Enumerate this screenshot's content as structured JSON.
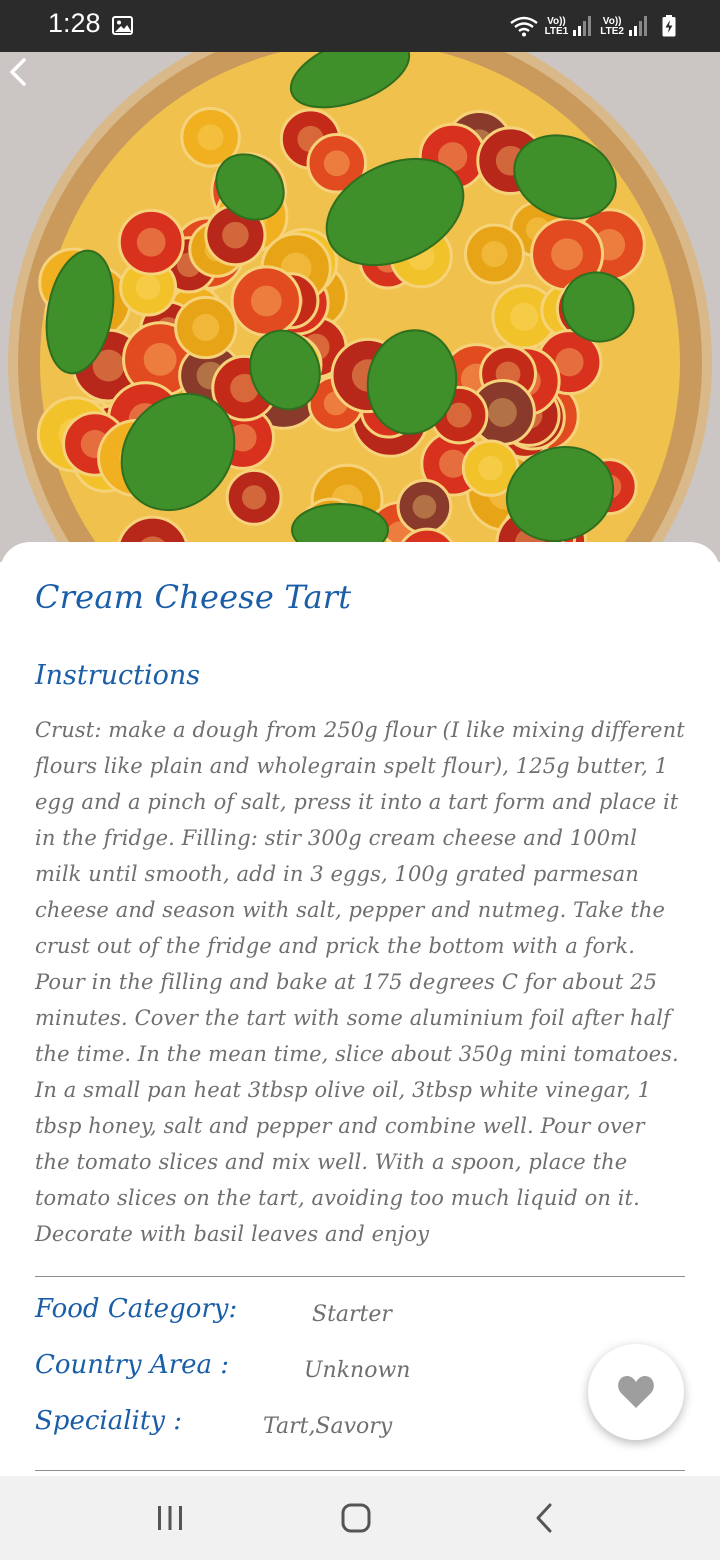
{
  "status_bar": {
    "time": "1:28",
    "sim1_label_top": "Vo))",
    "sim1_label_bottom": "LTE1",
    "sim2_label_top": "Vo))",
    "sim2_label_bottom": "LTE2",
    "icons": [
      "image-icon",
      "wifi-icon",
      "signal-icon",
      "signal-icon",
      "battery-charging-icon"
    ]
  },
  "header": {
    "back_icon": "chevron-left-icon"
  },
  "recipe": {
    "title": "Cream Cheese Tart",
    "instructions_heading": "Instructions",
    "instructions": "Crust: make a dough from 250g flour (I like mixing different flours like plain and wholegrain spelt flour), 125g butter, 1 egg and a pinch of salt, press it into a tart form and place it in the fridge. Filling: stir 300g cream cheese and 100ml milk until smooth, add in 3 eggs, 100g grated parmesan cheese and season with salt, pepper and nutmeg. Take the crust out of the fridge and prick the bottom with a fork. Pour in the filling and bake at 175 degrees C for about 25 minutes. Cover the tart with some aluminium foil after half the time. In the mean time, slice about 350g mini tomatoes. In a small pan heat 3tbsp olive oil, 3tbsp white vinegar, 1 tbsp honey, salt and pepper and combine well. Pour over the tomato slices and mix well. With a spoon, place the tomato slices on the tart, avoiding too much liquid on it. Decorate with basil leaves and enjoy",
    "category_label": "Food Category:",
    "category_value": "Starter",
    "area_label": "Country Area :",
    "area_value": "Unknown",
    "speciality_label": "Speciality :",
    "speciality_value": "Tart,Savory"
  },
  "favorite": {
    "icon": "heart-icon",
    "color": "#9e9e9e"
  },
  "nav_bar": {
    "icons": [
      "recent-apps-icon",
      "home-icon",
      "back-icon"
    ]
  },
  "colors": {
    "accent": "#1a5ea8",
    "body_text": "#6f6f6f",
    "status_bar": "#2b2b2b",
    "nav_bar": "#f1f1f1"
  }
}
